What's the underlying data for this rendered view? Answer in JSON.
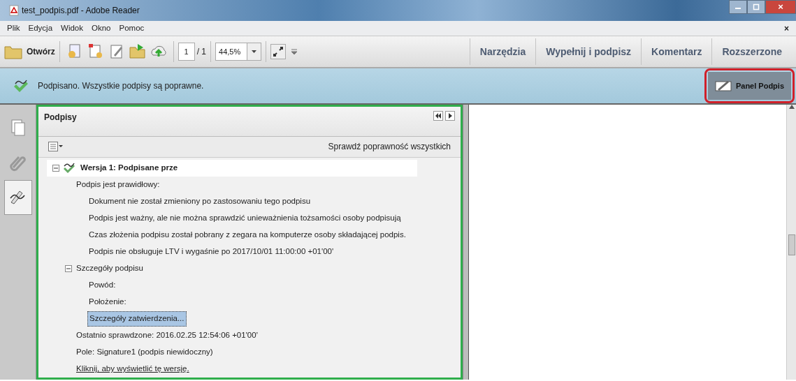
{
  "window": {
    "title": "test_podpis.pdf - Adobe Reader",
    "close_glyph": "×"
  },
  "menu": [
    "Plik",
    "Edycja",
    "Widok",
    "Okno",
    "Pomoc"
  ],
  "menu_close": "×",
  "toolbar": {
    "open_label": "Otwórz",
    "page": "1",
    "page_total": "/ 1",
    "zoom": "44,5%"
  },
  "tabs": [
    {
      "label": "Narzędzia",
      "selected": false
    },
    {
      "label": "Wypełnij i podpisz",
      "selected": false
    },
    {
      "label": "Komentarz",
      "selected": false
    },
    {
      "label": "Rozszerzone",
      "selected": false
    }
  ],
  "notification": {
    "text": "Podpisano. Wszystkie podpisy są poprawne.",
    "button": "Panel Podpis",
    "outlined": true
  },
  "nav": [
    {
      "kind": "pages",
      "selected": false
    },
    {
      "kind": "attachments",
      "selected": false
    },
    {
      "kind": "signatures",
      "selected": true
    }
  ],
  "panel": {
    "title": "Podpisy",
    "outlined": true,
    "verify_all": "Sprawdź poprawność wszystkich",
    "tree": [
      {
        "kind": "version",
        "text": "Wersja 1: Podpisane prze",
        "expanded": true,
        "selected": false,
        "children": [
          {
            "kind": "item",
            "text": "Podpis jest prawidłowy:",
            "selected": false,
            "children": [
              {
                "kind": "item",
                "text": "Dokument nie został zmieniony po zastosowaniu tego podpisu",
                "selected": false
              },
              {
                "kind": "item",
                "text": "Podpis jest ważny, ale nie można sprawdzić unieważnienia tożsamości osoby podpisują",
                "selected": false
              },
              {
                "kind": "item",
                "text": "Czas złożenia podpisu został pobrany z zegara na komputerze osoby składającej podpis.",
                "selected": false
              },
              {
                "kind": "item",
                "text": "Podpis nie obsługuje LTV i wygaśnie po 2017/10/01 11:00:00 +01'00'",
                "selected": false
              }
            ]
          },
          {
            "kind": "item",
            "text": "Szczegóły podpisu",
            "expanded": true,
            "selected": false,
            "children": [
              {
                "kind": "item",
                "text": "Powód:",
                "selected": false
              },
              {
                "kind": "item",
                "text": "Położenie:",
                "selected": false
              },
              {
                "kind": "item",
                "text": "Szczegóły zatwierdzenia...",
                "selected": true
              }
            ]
          },
          {
            "kind": "item",
            "text": "Ostatnio sprawdzone: 2016.02.25 12:54:06 +01'00'",
            "selected": false
          },
          {
            "kind": "item",
            "text": "Pole: Signature1 (podpis niewidoczny)",
            "selected": false
          },
          {
            "kind": "link",
            "text": "Kliknij, aby wyświetlić tę wersję.",
            "selected": false
          }
        ]
      }
    ]
  }
}
